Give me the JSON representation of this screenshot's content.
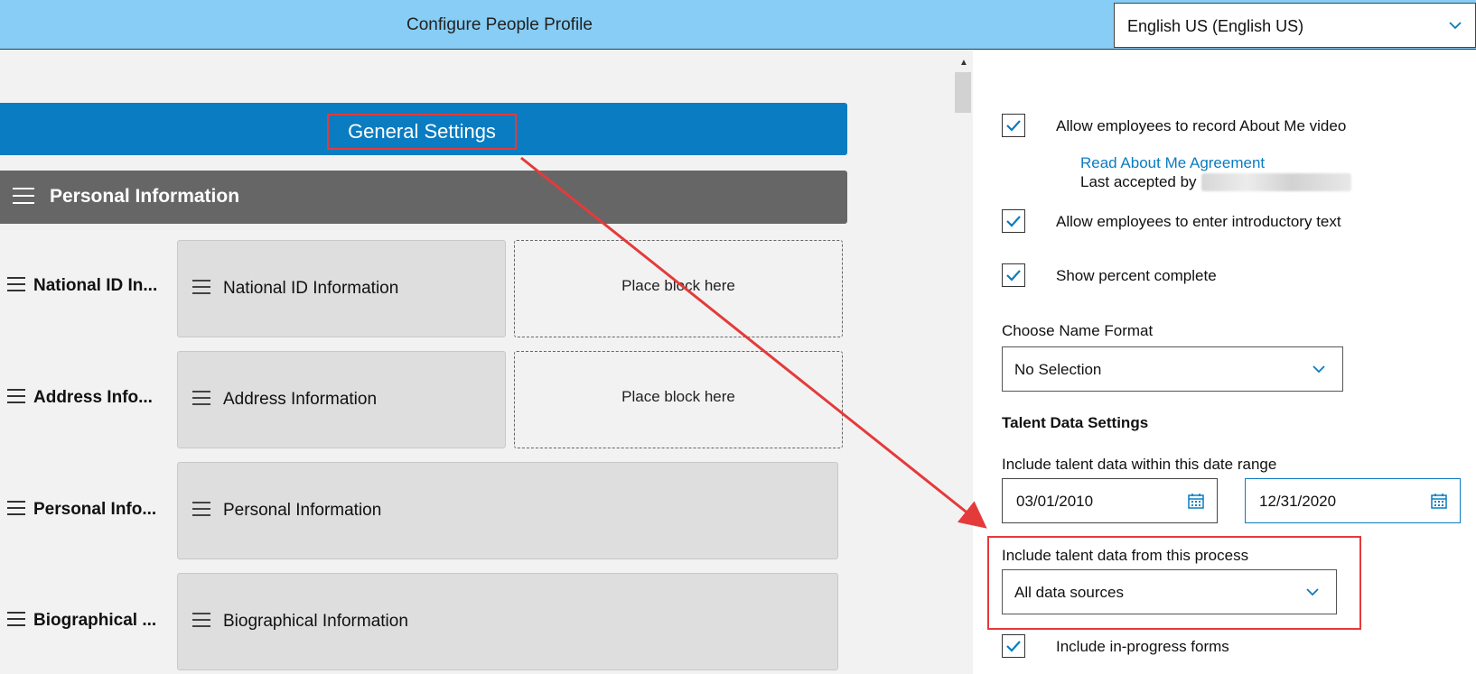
{
  "header": {
    "title": "Configure People Profile",
    "language_value": "English US (English US)"
  },
  "left_panel": {
    "general_settings_label": "General Settings",
    "section_title": "Personal Information",
    "placeholder_text": "Place block here",
    "rows": [
      {
        "label": "National ID In...",
        "block": "National ID Information",
        "has_placeholder": true
      },
      {
        "label": "Address Info...",
        "block": "Address Information",
        "has_placeholder": true
      },
      {
        "label": "Personal Info...",
        "block": "Personal Information",
        "has_placeholder": false
      },
      {
        "label": "Biographical ...",
        "block": "Biographical Information",
        "has_placeholder": false
      }
    ]
  },
  "right_panel": {
    "about_me_video_label": "Allow employees to record About Me video",
    "about_me_video_checked": true,
    "read_agreement_link": "Read About Me Agreement",
    "last_accepted_label": "Last accepted by",
    "intro_text_label": "Allow employees to enter introductory text",
    "intro_text_checked": true,
    "percent_complete_label": "Show percent complete",
    "percent_complete_checked": true,
    "name_format_label": "Choose Name Format",
    "name_format_value": "No Selection",
    "talent_heading": "Talent Data Settings",
    "date_range_label": "Include talent data within this date range",
    "date_from": "03/01/2010",
    "date_to": "12/31/2020",
    "process_label": "Include talent data from this process",
    "process_value": "All data sources",
    "in_progress_label": "Include in-progress forms",
    "in_progress_checked": true
  },
  "colors": {
    "header_bg": "#87cdf5",
    "primary_blue": "#0a7cc1",
    "section_gray": "#666666",
    "annotation_red": "#e53a3a"
  },
  "icons": {
    "chevron": "chevron-down-icon",
    "checkbox": "check-icon",
    "calendar": "calendar-icon",
    "drag": "drag-handle-icon"
  }
}
